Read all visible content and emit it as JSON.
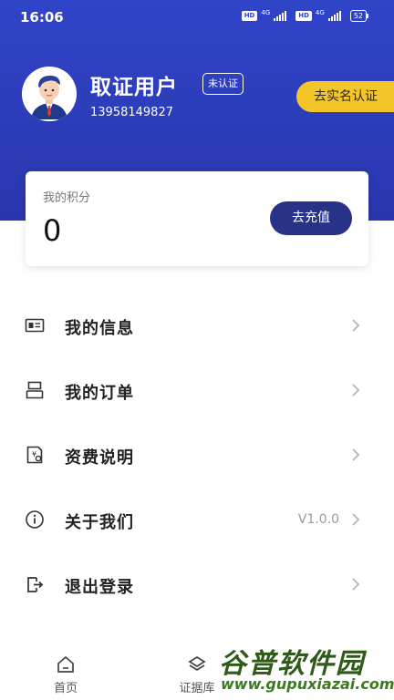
{
  "status_bar": {
    "time": "16:06",
    "hd1": "HD",
    "net1": "4G",
    "hd2": "HD",
    "net2": "4G",
    "battery": "52"
  },
  "profile": {
    "name": "取证用户",
    "cert_status": "未认证",
    "phone": "13958149827",
    "realname_button": "去实名认证"
  },
  "points": {
    "label": "我的积分",
    "value": "0",
    "recharge_button": "去充值"
  },
  "menu": [
    {
      "label": "我的信息",
      "icon": "id-card-icon",
      "value": ""
    },
    {
      "label": "我的订单",
      "icon": "order-icon",
      "value": ""
    },
    {
      "label": "资费说明",
      "icon": "fee-doc-icon",
      "value": ""
    },
    {
      "label": "关于我们",
      "icon": "info-icon",
      "value": "V1.0.0"
    },
    {
      "label": "退出登录",
      "icon": "logout-icon",
      "value": ""
    }
  ],
  "tabs": [
    {
      "label": "首页",
      "icon": "home-icon"
    },
    {
      "label": "证据库",
      "icon": "layers-icon"
    }
  ],
  "watermark": {
    "title": "谷普软件园",
    "url": "www.gupuxiazai.com"
  },
  "colors": {
    "header_blue": "#3044c8",
    "accent_yellow": "#f3c527",
    "button_navy": "#283286"
  }
}
